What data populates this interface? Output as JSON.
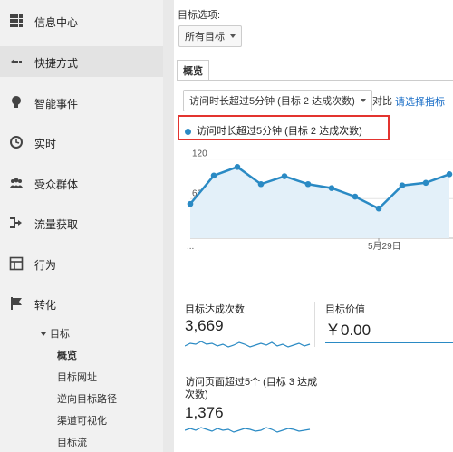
{
  "sidebar": {
    "items": [
      {
        "label": "信息中心",
        "icon": "dashboard-grid-icon"
      },
      {
        "label": "快捷方式",
        "icon": "shortcut-arrow-icon"
      },
      {
        "label": "智能事件",
        "icon": "lightbulb-icon"
      },
      {
        "label": "实时",
        "icon": "clock-icon"
      },
      {
        "label": "受众群体",
        "icon": "people-icon"
      },
      {
        "label": "流量获取",
        "icon": "acquisition-icon"
      },
      {
        "label": "行为",
        "icon": "behavior-icon"
      },
      {
        "label": "转化",
        "icon": "flag-icon"
      }
    ],
    "sub_header": "目标",
    "sub_items": [
      "概览",
      "目标网址",
      "逆向目标路径",
      "渠道可视化",
      "目标流"
    ]
  },
  "main": {
    "goal_option_label": "目标选项:",
    "goal_select": "所有目标",
    "tab_overview": "概览",
    "metric_select": "访问时长超过5分钟 (目标 2 达成次数)",
    "compare_label": "对比",
    "select_metric_link": "请选择指标",
    "legend_label": "访问时长超过5分钟 (目标 2 达成次数)",
    "legend_color": "#2a8ac4"
  },
  "chart_data": {
    "type": "area",
    "y_ticks": [
      "120",
      "60"
    ],
    "x_ticks": [
      "...",
      "5月29日"
    ],
    "series": [
      {
        "name": "访问时长超过5分钟 (目标 2 达成次数)",
        "values": [
          52,
          95,
          108,
          82,
          94,
          82,
          76,
          63,
          45,
          80,
          84,
          97
        ]
      }
    ],
    "ylim": [
      0,
      140
    ]
  },
  "metrics": [
    {
      "label": "目标达成次数",
      "value": "3,669"
    },
    {
      "label": "目标价值",
      "value": "￥0.00"
    },
    {
      "label": "访问页面超过5个 (目标 3 达成次数)",
      "value": "1,376"
    }
  ]
}
